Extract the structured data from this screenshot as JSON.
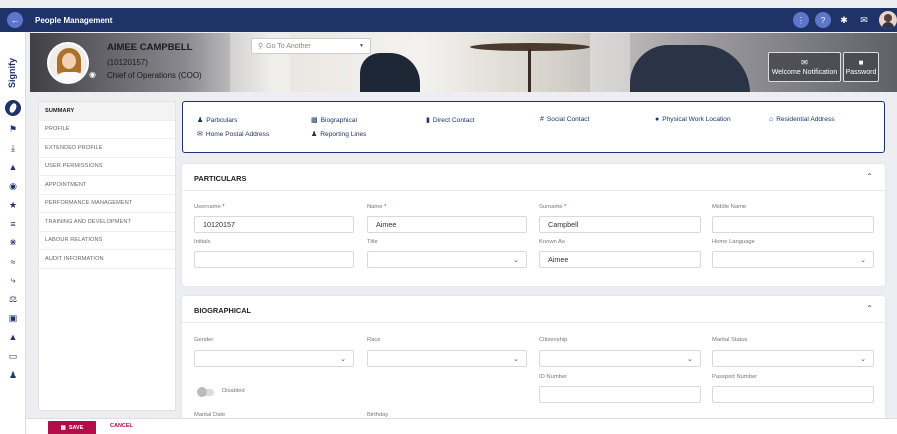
{
  "app": {
    "title": "People Management"
  },
  "employee": {
    "name": "AIMEE CAMPBELL",
    "id_display": "(10120157)",
    "job_title": "Chief of Operations (COO)"
  },
  "search": {
    "placeholder": "Go To Another"
  },
  "header_buttons": {
    "welcome": "Welcome Notification",
    "password": "Password"
  },
  "brand": {
    "name": "Signify"
  },
  "menu": [
    "SUMMARY",
    "PROFILE",
    "EXTENDED PROFILE",
    "USER PERMISSIONS",
    "APPOINTMENT",
    "PERFORMANCE MANAGEMENT",
    "TRAINING AND DEVELOPMENT",
    "LABOUR RELATIONS",
    "AUDIT INFORMATION"
  ],
  "quick_links": {
    "particulars": "Particulars",
    "biographical": "Biographical",
    "direct_contact": "Direct Contact",
    "social_contact": "Social Contact",
    "physical_work_location": "Physical Work Location",
    "residential_address": "Residential Address",
    "home_postal_address": "Home Postal Address",
    "reporting_lines": "Reporting Lines"
  },
  "particulars": {
    "title": "PARTICULARS",
    "username_label": "Username",
    "username": "10120157",
    "name_label": "Name",
    "name": "Aimee",
    "surname_label": "Surname",
    "surname": "Campbell",
    "middle_name_label": "Middle Name",
    "middle_name": "",
    "initials_label": "Initials",
    "initials": "",
    "title_label": "Title",
    "title_value": "",
    "known_as_label": "Known As",
    "known_as": "Aimee",
    "home_language_label": "Home Language",
    "home_language": ""
  },
  "biographical": {
    "title": "BIOGRAPHICAL",
    "gender_label": "Gender",
    "race_label": "Race",
    "citizenship_label": "Citizenship",
    "marital_status_label": "Marital Status",
    "disabled_label": "Disabled",
    "id_number_label": "ID Number",
    "passport_number_label": "Passport Number",
    "marital_date_label": "Marital Date",
    "birthday_label": "Birthday"
  },
  "footer": {
    "save": "SAVE",
    "cancel": "CANCEL"
  },
  "colors": {
    "primary": "#1f3368",
    "accent": "#b00d49",
    "badge": "#5d76c9"
  }
}
